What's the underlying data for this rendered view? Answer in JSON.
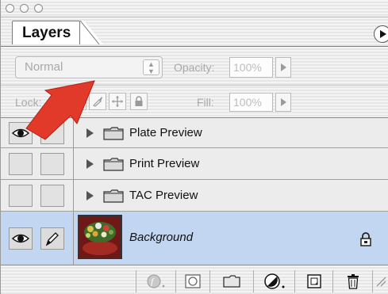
{
  "panel": {
    "tab_label": "Layers"
  },
  "controls": {
    "blend_mode": "Normal",
    "opacity_label": "Opacity:",
    "opacity_value": "100%",
    "lock_label": "Lock:",
    "fill_label": "Fill:",
    "fill_value": "100%"
  },
  "layers": [
    {
      "name": "Plate Preview",
      "type": "folder",
      "visible": true,
      "selected": false
    },
    {
      "name": "Print Preview",
      "type": "folder",
      "visible": false,
      "selected": false
    },
    {
      "name": "TAC Preview",
      "type": "folder",
      "visible": false,
      "selected": false
    },
    {
      "name": "Background",
      "type": "image",
      "visible": true,
      "selected": true,
      "locked": true
    }
  ],
  "icons": {
    "visibility": "eye-icon",
    "brush": "brush-icon",
    "lock": "lock-icon",
    "folder": "folder-icon",
    "disclosure": "disclosure-triangle-icon",
    "layer_style": "layer-style-icon",
    "mask": "layer-mask-icon",
    "new_set": "new-folder-icon",
    "adjustment": "adjustment-layer-icon",
    "new_layer": "new-layer-icon",
    "trash": "trash-icon"
  },
  "colors": {
    "selection": "#c2d6f1",
    "callout_arrow": "#e23a2a"
  }
}
